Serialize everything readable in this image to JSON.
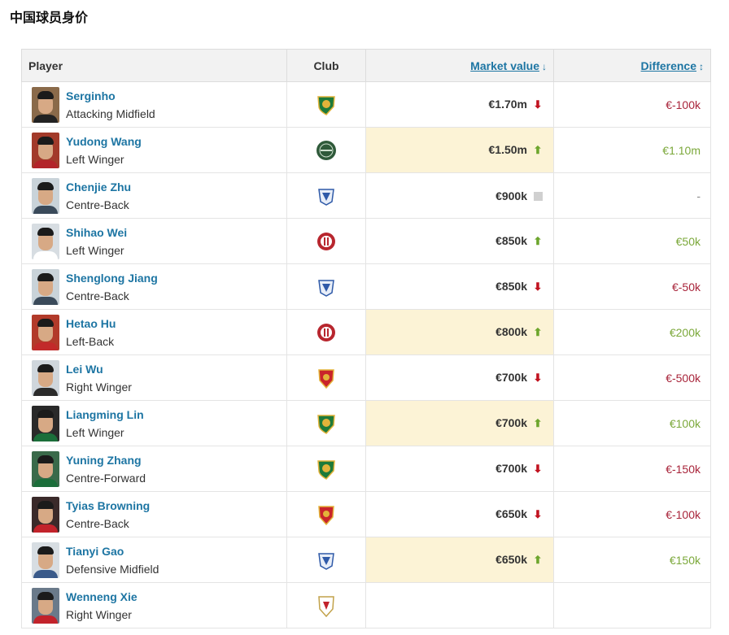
{
  "page_title": "中国球员身价",
  "header": {
    "player": "Player",
    "club": "Club",
    "market_value": "Market value",
    "market_value_sort_icon": "arrow-down-icon",
    "difference": "Difference",
    "difference_sort_icon": "sort-up-down-icon"
  },
  "colors": {
    "link": "#1d75a3",
    "highlight_row": "#fcf3d6",
    "arrow_down": "#c1121f",
    "arrow_up": "#6ca52c",
    "diff_negative": "#a8243a",
    "diff_positive": "#7ba83a"
  },
  "players": [
    {
      "name": "Serginho",
      "position": "Attacking Midfield",
      "club_icon": "green-shield-badge-icon",
      "value": "€1.70m",
      "trend": "down",
      "difference": "€-100k",
      "highlight": false
    },
    {
      "name": "Yudong Wang",
      "position": "Left Winger",
      "club_icon": "dark-green-round-badge-icon",
      "value": "€1.50m",
      "trend": "up",
      "difference": "€1.10m",
      "highlight": true
    },
    {
      "name": "Chenjie Zhu",
      "position": "Centre-Back",
      "club_icon": "blue-shenhua-badge-icon",
      "value": "€900k",
      "trend": "same",
      "difference": "-",
      "highlight": false
    },
    {
      "name": "Shihao Wei",
      "position": "Left Winger",
      "club_icon": "red-round-badge-icon",
      "value": "€850k",
      "trend": "up",
      "difference": "€50k",
      "highlight": false
    },
    {
      "name": "Shenglong Jiang",
      "position": "Centre-Back",
      "club_icon": "blue-shenhua-badge-icon",
      "value": "€850k",
      "trend": "down",
      "difference": "€-50k",
      "highlight": false
    },
    {
      "name": "Hetao Hu",
      "position": "Left-Back",
      "club_icon": "red-round-badge-icon",
      "value": "€800k",
      "trend": "up",
      "difference": "€200k",
      "highlight": true
    },
    {
      "name": "Lei Wu",
      "position": "Right Winger",
      "club_icon": "red-shanghai-port-badge-icon",
      "value": "€700k",
      "trend": "down",
      "difference": "€-500k",
      "highlight": false
    },
    {
      "name": "Liangming Lin",
      "position": "Left Winger",
      "club_icon": "green-shield-badge-icon",
      "value": "€700k",
      "trend": "up",
      "difference": "€100k",
      "highlight": true
    },
    {
      "name": "Yuning Zhang",
      "position": "Centre-Forward",
      "club_icon": "green-shield-badge-icon",
      "value": "€700k",
      "trend": "down",
      "difference": "€-150k",
      "highlight": false
    },
    {
      "name": "Tyias Browning",
      "position": "Centre-Back",
      "club_icon": "red-shanghai-port-badge-icon",
      "value": "€650k",
      "trend": "down",
      "difference": "€-100k",
      "highlight": false
    },
    {
      "name": "Tianyi Gao",
      "position": "Defensive Midfield",
      "club_icon": "blue-shenhua-badge-icon",
      "value": "€650k",
      "trend": "up",
      "difference": "€150k",
      "highlight": true
    },
    {
      "name": "Wenneng Xie",
      "position": "Right Winger",
      "club_icon": "white-red-shield-badge-icon",
      "value": "",
      "trend": "",
      "difference": "",
      "highlight": false
    }
  ]
}
